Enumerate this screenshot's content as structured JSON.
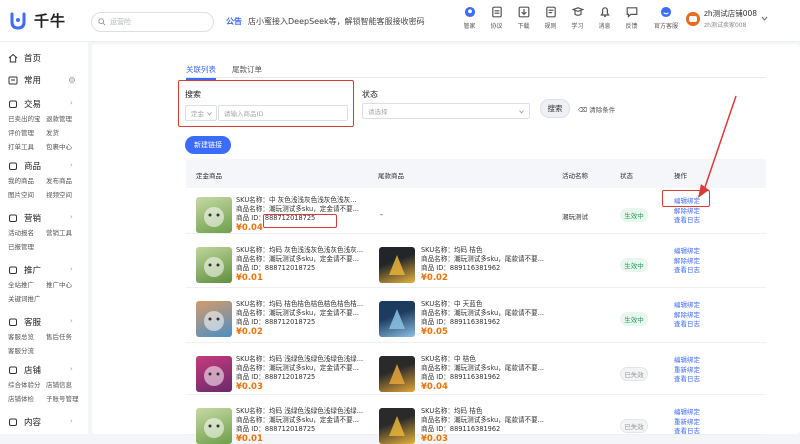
{
  "app": {
    "name": "千牛"
  },
  "header": {
    "search_placeholder": "运营险",
    "notice_tag": "公告",
    "notice_text": "店小蜜接入DeepSeek等，解锁智能客服接收密码",
    "tools": [
      {
        "label": "管家",
        "icon": "butler-icon"
      },
      {
        "label": "协议",
        "icon": "document-icon"
      },
      {
        "label": "下载",
        "icon": "download-icon"
      },
      {
        "label": "规则",
        "icon": "rule-icon"
      },
      {
        "label": "学习",
        "icon": "learn-icon"
      },
      {
        "label": "消息",
        "icon": "bell-icon"
      },
      {
        "label": "反馈",
        "icon": "feedback-icon"
      },
      {
        "label": "官方客服",
        "icon": "support-icon"
      }
    ],
    "user": {
      "name": "zh测试店铺008",
      "sub": "zh测试卖家008"
    }
  },
  "sidebar": {
    "home": "首页",
    "common": "常用",
    "sections": [
      {
        "title": "交易",
        "items": [
          "已卖出的宝",
          "退款管理",
          "评价管理",
          "发货",
          "打单工具",
          "包裹中心"
        ]
      },
      {
        "title": "商品",
        "items": [
          "我的商品",
          "发布商品",
          "图片空间",
          "视频空间"
        ]
      },
      {
        "title": "营销",
        "items": [
          "活动报名",
          "营销工具",
          "已报管理"
        ]
      },
      {
        "title": "推广",
        "items": [
          "全站推广",
          "推广中心",
          "关键词推广"
        ]
      },
      {
        "title": "客服",
        "items": [
          "客服总览",
          "售后任务",
          "客服分流"
        ]
      },
      {
        "title": "店铺",
        "items": [
          "综合体验分",
          "店铺信息",
          "店铺体检",
          "子账号管理"
        ]
      },
      {
        "title": "内容",
        "items": []
      }
    ]
  },
  "tabs": [
    "关联列表",
    "尾款订单"
  ],
  "filters": {
    "search_label": "搜索",
    "search_type": "定金",
    "search_placeholder": "请输入商品ID",
    "status_label": "状态",
    "status_placeholder": "请选择",
    "search_button": "搜索",
    "clear_button": "清除条件"
  },
  "new_button": "新建链接",
  "table": {
    "headers": [
      "定金商品",
      "尾款商品",
      "活动名称",
      "状态",
      "操作"
    ],
    "rows": [
      {
        "deposit": {
          "sku": "SKU名称：中 灰色浅浅灰色浅灰色浅灰...",
          "name": "商品名称：潮玩测试多sku，定金请不要...",
          "id_label": "商品 ID：",
          "id": "888712018725",
          "price": "¥0.04"
        },
        "final": null,
        "final_placeholder": "-",
        "activity": "潮玩测试",
        "status": "生效中",
        "status_type": "ok",
        "ops": [
          "编辑绑定",
          "解除绑定",
          "查看日志"
        ]
      },
      {
        "deposit": {
          "sku": "SKU名称：均码 灰色浅浅灰色浅灰色浅灰...",
          "name": "商品名称：潮玩测试多sku，定金请不要...",
          "id_label": "商品 ID：",
          "id": "888712018725",
          "price": "¥0.01"
        },
        "final": {
          "sku": "SKU名称：均码 桔色",
          "name": "商品名称：潮玩测试多sku，尾款请不要...",
          "id_label": "商品 ID：",
          "id": "889116381962",
          "price": "¥0.02"
        },
        "activity": "",
        "status": "生效中",
        "status_type": "ok",
        "ops": [
          "编辑绑定",
          "解除绑定",
          "查看日志"
        ]
      },
      {
        "deposit": {
          "sku": "SKU名称：均码 桔色桔色桔色桔色桔色桔...",
          "name": "商品名称：潮玩测试多sku，定金请不要...",
          "id_label": "商品 ID：",
          "id": "888712018725",
          "price": "¥0.02"
        },
        "final": {
          "sku": "SKU名称：中 天蓝色",
          "name": "商品名称：潮玩测试多sku，尾款请不要...",
          "id_label": "商品 ID：",
          "id": "889116381962",
          "price": "¥0.05"
        },
        "activity": "",
        "status": "生效中",
        "status_type": "ok",
        "ops": [
          "编辑绑定",
          "解除绑定",
          "查看日志"
        ]
      },
      {
        "deposit": {
          "sku": "SKU名称：均码 浅绿色浅绿色浅绿色浅绿...",
          "name": "商品名称：潮玩测试多sku，定金请不要...",
          "id_label": "商品 ID：",
          "id": "888712018725",
          "price": "¥0.03"
        },
        "final": {
          "sku": "SKU名称：中 桔色",
          "name": "商品名称：潮玩测试多sku，尾款请不要...",
          "id_label": "商品 ID：",
          "id": "889116381962",
          "price": "¥0.04"
        },
        "activity": "",
        "status": "已失效",
        "status_type": "off",
        "ops": [
          "编辑绑定",
          "重新绑定",
          "查看日志"
        ]
      },
      {
        "deposit": {
          "sku": "SKU名称：均码 浅绿色浅绿色浅绿色浅绿...",
          "name": "商品名称：潮玩测试多sku，定金请不要...",
          "id_label": "商品 ID：",
          "id": "888712018725",
          "price": "¥0.01"
        },
        "final": {
          "sku": "SKU名称：均码 桔色",
          "name": "商品名称：潮玩测试多sku，尾款请不要...",
          "id_label": "商品 ID：",
          "id": "889116381962",
          "price": "¥0.03"
        },
        "activity": "",
        "status": "已失效",
        "status_type": "off",
        "ops": [
          "编辑绑定",
          "重新绑定",
          "查看日志"
        ]
      }
    ]
  },
  "colors": {
    "accent": "#3b6cff",
    "price": "#e8740d",
    "annotation": "#d93a3a",
    "ok": "#1fa35d"
  }
}
